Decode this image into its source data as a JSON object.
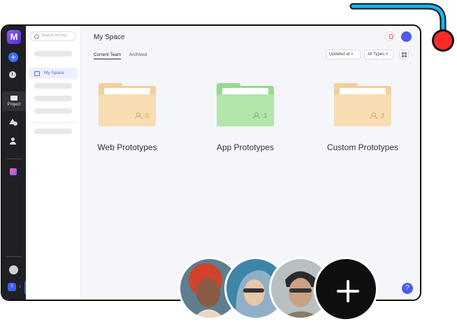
{
  "app": {
    "logo_letter": "M"
  },
  "rail": {
    "project_label": "Project",
    "team_badge": "f",
    "team_indicator": "↕"
  },
  "sidebar": {
    "search_placeholder": "Search for Proj",
    "active_item": "My Space"
  },
  "header": {
    "title": "My Space",
    "tabs": [
      "Current Team",
      "Archived"
    ],
    "sort_label": "Updated at",
    "type_filter": "All Types",
    "chevron": "▾"
  },
  "projects": [
    {
      "name": "Web Prototypes",
      "members": "5",
      "color": "orange"
    },
    {
      "name": "App Prototypes",
      "members": "3",
      "color": "green"
    },
    {
      "name": "Custom Prototypes",
      "members": "3",
      "color": "orange"
    }
  ],
  "help": {
    "label": "?"
  },
  "colors": {
    "accent": "#4f5af0",
    "rail": "#1f2023",
    "folder_orange": "#f8ddb3",
    "folder_green": "#b3e6aa",
    "cable": "#15b4ef",
    "plug": "#ff2a2a"
  },
  "icons": [
    "plus-icon",
    "clock-icon",
    "folder-icon",
    "shapes-icon",
    "user-icon",
    "plugin-icon",
    "search-icon",
    "bell-icon",
    "grid-icon",
    "people-icon",
    "help-icon"
  ]
}
